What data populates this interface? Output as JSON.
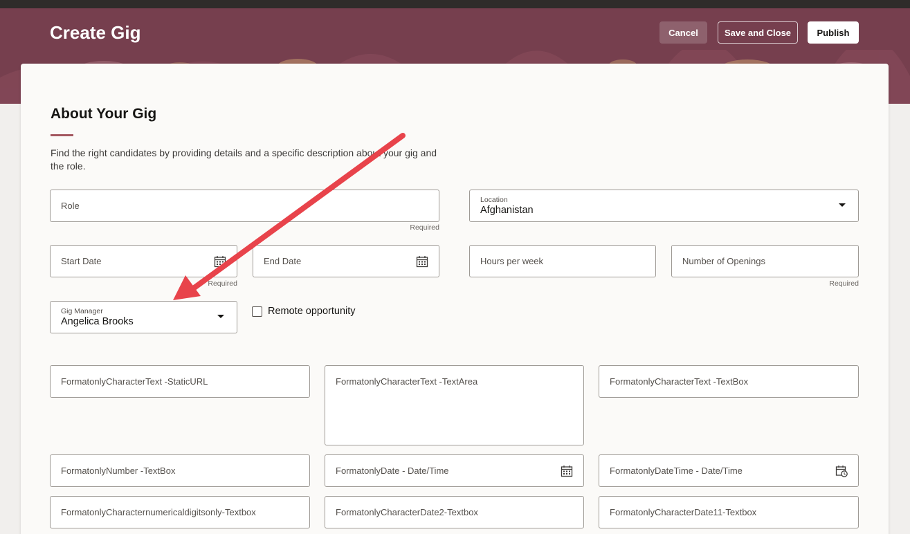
{
  "header": {
    "title": "Create Gig",
    "cancel_label": "Cancel",
    "save_close_label": "Save and Close",
    "publish_label": "Publish",
    "bg_color": "#763f4e"
  },
  "section": {
    "title": "About Your Gig",
    "description": "Find the right candidates by providing details and a specific description about your gig and the role."
  },
  "fields": {
    "role": {
      "placeholder": "Role",
      "required": "Required"
    },
    "location": {
      "label": "Location",
      "value": "Afghanistan"
    },
    "start_date": {
      "placeholder": "Start Date",
      "required": "Required"
    },
    "end_date": {
      "placeholder": "End Date"
    },
    "hours_per_week": {
      "placeholder": "Hours per week"
    },
    "number_of_openings": {
      "placeholder": "Number of Openings",
      "required": "Required"
    },
    "gig_manager": {
      "label": "Gig Manager",
      "value": "Angelica Brooks"
    },
    "remote": {
      "label": "Remote opportunity",
      "checked": false
    }
  },
  "custom_fields": {
    "static_url": "FormatonlyCharacterText -StaticURL",
    "text_area": "FormatonlyCharacterText -TextArea",
    "text_box": "FormatonlyCharacterText -TextBox",
    "number_box": "FormatonlyNumber -TextBox",
    "date_time": "FormatonlyDate - Date/Time",
    "datetime_time": "FormatonlyDateTime - Date/Time",
    "numerical_digits": "FormatonlyCharacternumericaldigitsonly-Textbox",
    "date2": "FormatonlyCharacterDate2-Textbox",
    "date11": "FormatonlyCharacterDate11-Textbox"
  },
  "annotation": {
    "arrow_color": "#e8434b"
  }
}
